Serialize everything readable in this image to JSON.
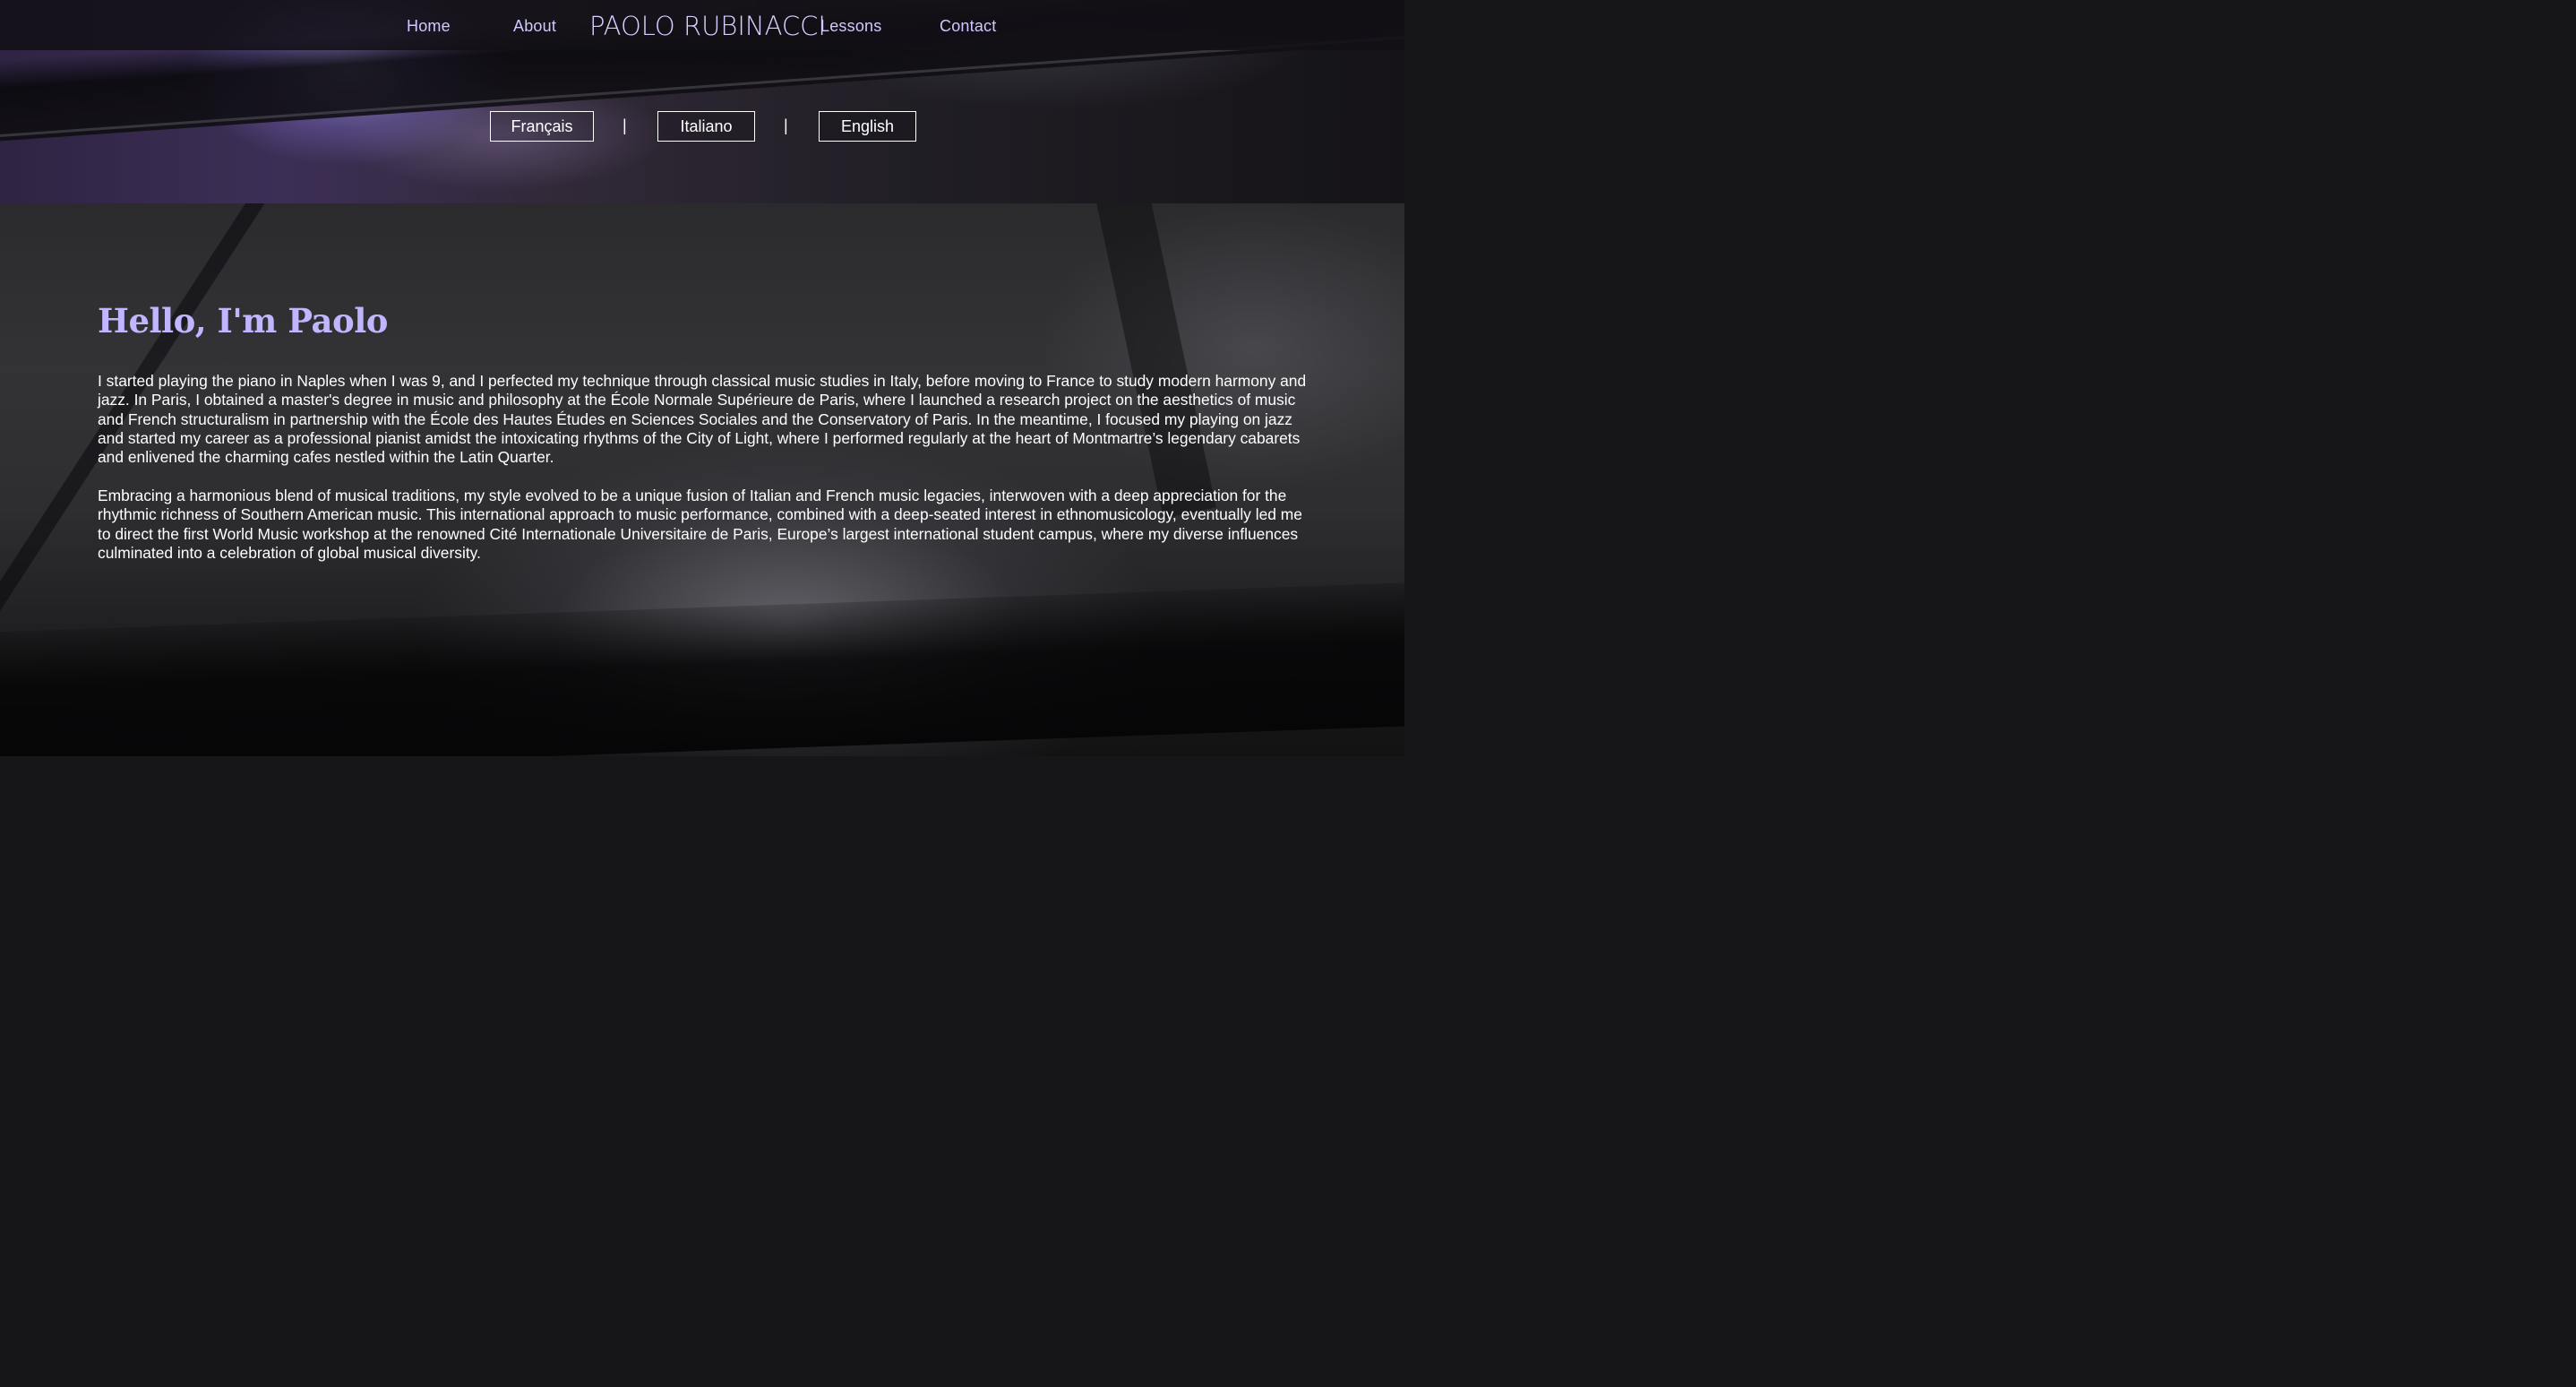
{
  "nav": {
    "links": [
      "Home",
      "About",
      "Lessons",
      "Contact"
    ],
    "logo": "PAOLO RUBINACCI"
  },
  "languages": {
    "options": [
      "Français",
      "Italiano",
      "English"
    ],
    "separator": "|"
  },
  "content": {
    "heading": "Hello, I'm Paolo",
    "paragraphs": [
      "I started playing the piano in Naples when I was 9, and I perfected my technique through classical music studies in Italy, before moving to France to study modern harmony and jazz. In Paris, I obtained a master's degree in music and philosophy at the École Normale Supérieure de Paris, where I launched a research project on the aesthetics of music and French structuralism in partnership with the École des Hautes Études en Sciences Sociales and the Conservatory of Paris. In the meantime, I focused my playing on jazz and started my career as a professional pianist amidst the intoxicating rhythms of the City of Light, where I performed regularly at the heart of Montmartre’s legendary cabarets and enlivened the charming cafes nestled within the Latin Quarter.",
      "Embracing a harmonious blend of musical traditions, my style evolved to be a unique fusion of Italian and French music legacies, interwoven with a deep appreciation for the rhythmic richness of Southern American music. This international approach to music performance, combined with a deep-seated interest in ethnomusicology, eventually led me to direct the first World Music workshop at the renowned Cité Internationale Universitaire de Paris, Europe’s largest international student campus, where my diverse influences culminated into a celebration of global musical diversity."
    ]
  },
  "colors": {
    "accent": "#c0b5ff",
    "nav_text": "#cfc9ff",
    "text": "#ffffff"
  }
}
